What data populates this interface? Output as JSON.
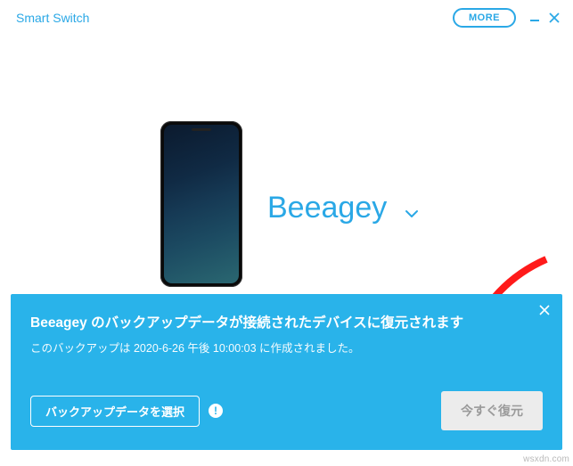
{
  "app": {
    "title": "Smart Switch"
  },
  "titlebar": {
    "more_label": "MORE"
  },
  "device": {
    "name": "Beeagey"
  },
  "banner": {
    "title": "Beeagey のバックアップデータが接続されたデバイスに復元されます",
    "subtitle": "このバックアップは 2020-6-26 午後 10:00:03 に作成されました。",
    "select_backup_label": "バックアップデータを選択",
    "restore_label": "今すぐ復元"
  },
  "watermark": "wsxdn.com"
}
